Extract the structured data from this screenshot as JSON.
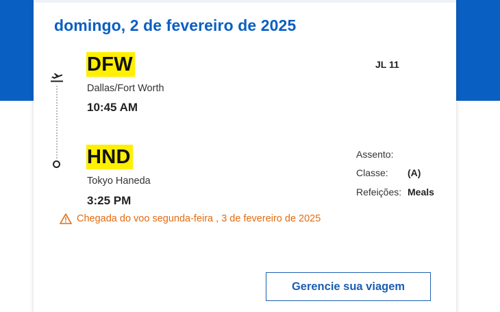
{
  "itinerary": {
    "date_heading": "domingo, 2 de fevereiro de 2025",
    "departure": {
      "code": "DFW",
      "city": "Dallas/Fort Worth",
      "time": "10:45 AM",
      "icon": "plane-departure-icon"
    },
    "arrival": {
      "code": "HND",
      "city": "Tokyo Haneda",
      "time": "3:25 PM",
      "icon": "arrival-circle-icon"
    },
    "flight_number": "JL 11",
    "details": {
      "seat_label": "Assento:",
      "seat_value": "",
      "class_label": "Classe:",
      "class_value": "(A)",
      "meal_label": "Refeições:",
      "meal_value": "Meals"
    },
    "arrival_notice": "Chegada do voo segunda-feira , 3 de fevereiro de 2025",
    "manage_button": "Gerencie sua viagem"
  },
  "colors": {
    "brand_blue": "#0a5fc2",
    "code_highlight": "#ffef00",
    "warning_orange": "#e36b10"
  }
}
